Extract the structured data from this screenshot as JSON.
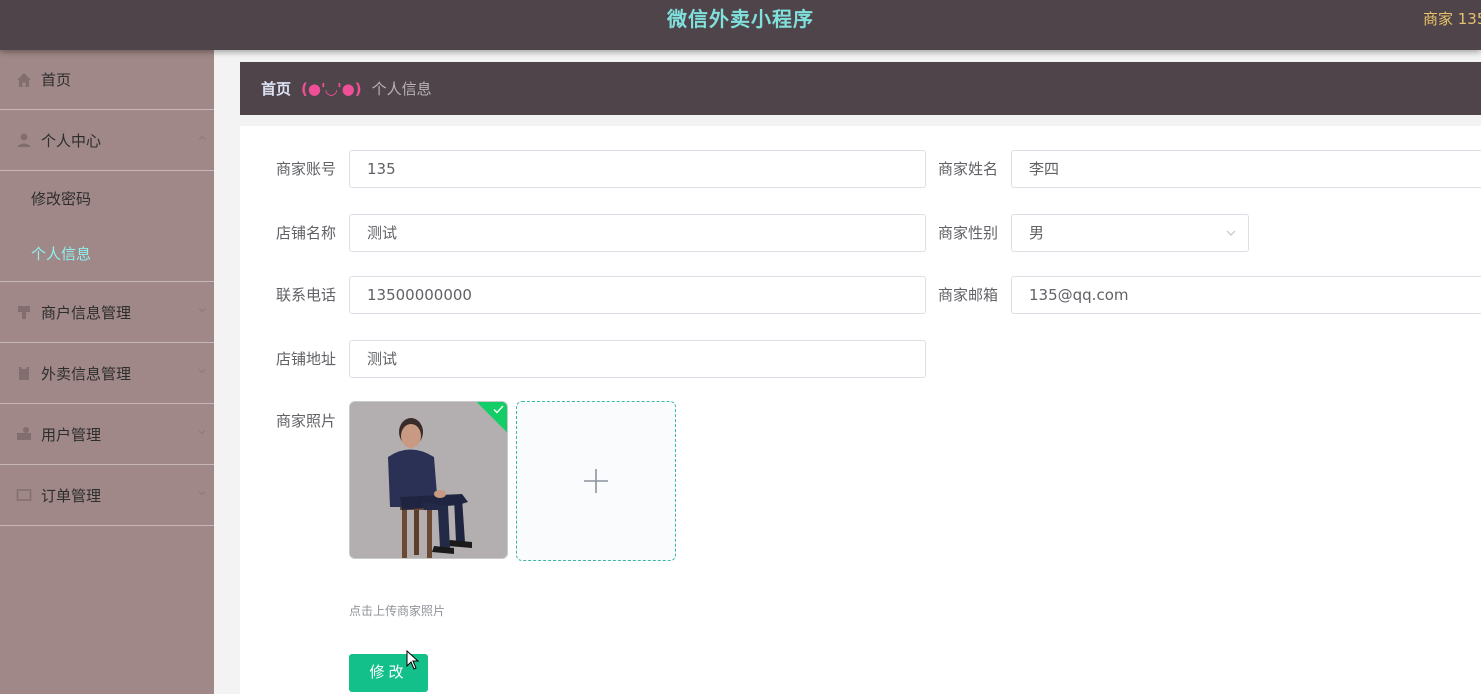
{
  "header": {
    "title": "微信外卖小程序",
    "user": "商家 135"
  },
  "sidebar": {
    "items": [
      {
        "label": "首页",
        "icon": "home-icon"
      },
      {
        "label": "个人中心",
        "icon": "user-icon",
        "children": [
          "修改密码",
          "个人信息"
        ],
        "active_child": "个人信息"
      },
      {
        "label": "商户信息管理",
        "icon": "shop-icon"
      },
      {
        "label": "外卖信息管理",
        "icon": "clipboard-icon"
      },
      {
        "label": "用户管理",
        "icon": "users-icon"
      },
      {
        "label": "订单管理",
        "icon": "order-icon"
      }
    ]
  },
  "breadcrumb": {
    "home": "首页",
    "face": "(●'◡'●)",
    "current": "个人信息"
  },
  "form": {
    "account": {
      "label": "商家账号",
      "value": "135"
    },
    "name": {
      "label": "商家姓名",
      "value": "李四"
    },
    "shop_name": {
      "label": "店铺名称",
      "value": "测试"
    },
    "gender": {
      "label": "商家性别",
      "value": "男"
    },
    "phone": {
      "label": "联系电话",
      "value": "13500000000"
    },
    "email": {
      "label": "商家邮箱",
      "value": "135@qq.com"
    },
    "address": {
      "label": "店铺地址",
      "value": "测试"
    },
    "photo": {
      "label": "商家照片",
      "hint": "点击上传商家照片"
    },
    "submit_label": "修改"
  },
  "colors": {
    "accent": "#13c08a",
    "header_bg": "#4e4449",
    "sidebar_bg": "#a08888",
    "active_text": "#8ff0ec"
  }
}
